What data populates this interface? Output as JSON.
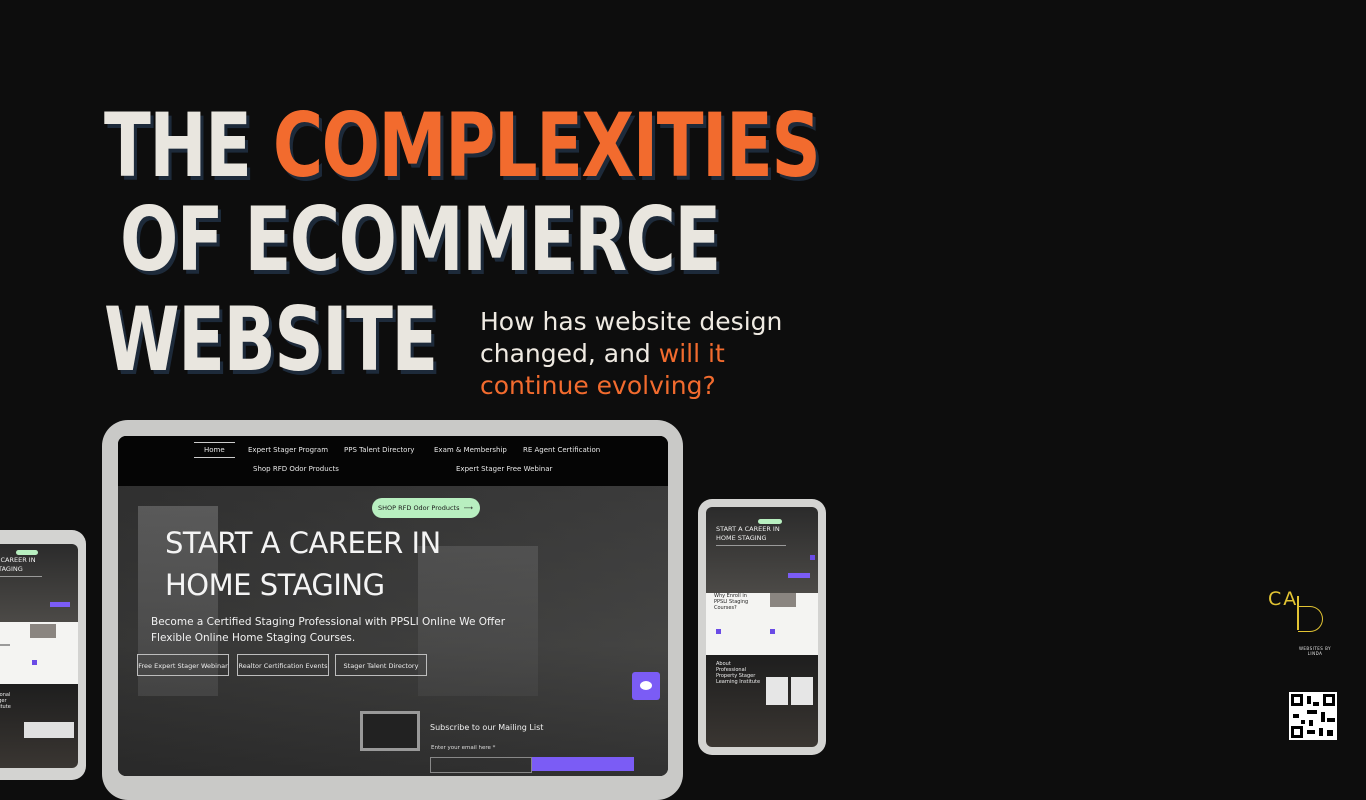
{
  "headline": {
    "line1_plain": "THE",
    "line1_accent": "COMPLEXITIES",
    "line2": "OF ECOMMERCE",
    "line3": "WEBSITE"
  },
  "subheadline": {
    "part1": "How has website design changed, and",
    "accent": "will it continue evolving?"
  },
  "colors": {
    "accent": "#f26b2e",
    "background": "#0d0d0d",
    "headline": "#e9e6df",
    "site_purple": "#7b5cf5",
    "pill_green": "#b8efc0",
    "logo_gold": "#e2c433"
  },
  "tablet": {
    "nav": {
      "home": "Home",
      "expert_stager_program": "Expert Stager Program",
      "pps_talent_directory": "PPS Talent Directory",
      "exam_membership": "Exam & Membership",
      "re_agent_certification": "RE Agent Certification",
      "shop_rfd": "Shop RFD Odor Products",
      "expert_stager_webinar": "Expert Stager Free Webinar"
    },
    "shop_pill": "SHOP RFD Odor Products",
    "shop_pill_arrow": "⟶",
    "hero_title_line1": "START A CAREER IN",
    "hero_title_line2": "HOME STAGING",
    "hero_desc": "Become a Certified Staging Professional with PPSLI Online We Offer Flexible Online Home Staging Courses.",
    "buttons": {
      "webinar": "Free Expert Stager Webinar",
      "realtor": "Realtor Certification Events",
      "directory": "Stager Talent Directory"
    },
    "subscribe_title": "Subscribe to our Mailing List",
    "email_label": "Enter your email here *"
  },
  "phone_right": {
    "hero_title": "START A CAREER IN HOME STAGING",
    "section_title": "Why Enroll in PPSLI Staging Courses?",
    "dark_title": "About Professional Property Stager Learning Institute"
  },
  "phone_left": {
    "hero_title": "A CAREER IN STAGING",
    "dark_title": "essional Stager Institute"
  },
  "logo": {
    "letters": "CA",
    "tagline": "WEBSITES BY LINDA"
  }
}
